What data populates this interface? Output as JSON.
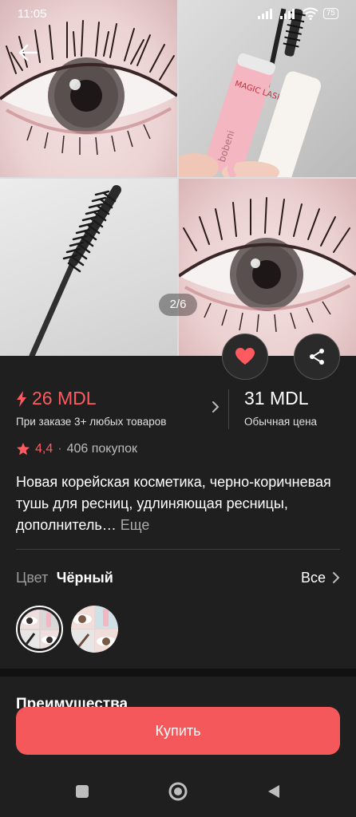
{
  "status_bar": {
    "time": "11:05",
    "battery": "75"
  },
  "gallery": {
    "counter": "2/6",
    "brand_text": "bobeni",
    "tube_text": "MAGIC LASH"
  },
  "promo": {
    "price": "26 MDL",
    "subtitle": "При заказе 3+ любых товаров"
  },
  "regular": {
    "price": "31 MDL",
    "subtitle": "Обычная цена"
  },
  "rating": {
    "score": "4,4",
    "purchases": "406 покупок"
  },
  "product": {
    "title": "Новая корейская косметика, черно-коричневая тушь для ресниц, удлиняющая ресницы, дополнитель…",
    "more": "Еще"
  },
  "color": {
    "label": "Цвет",
    "value": "Чёрный",
    "all": "Все"
  },
  "section": {
    "advantages": "Преимущества"
  },
  "buy": {
    "label": "Купить"
  },
  "colors": {
    "accent": "#ff5a5f",
    "button": "#f5585b",
    "background": "#1f1f1f"
  }
}
